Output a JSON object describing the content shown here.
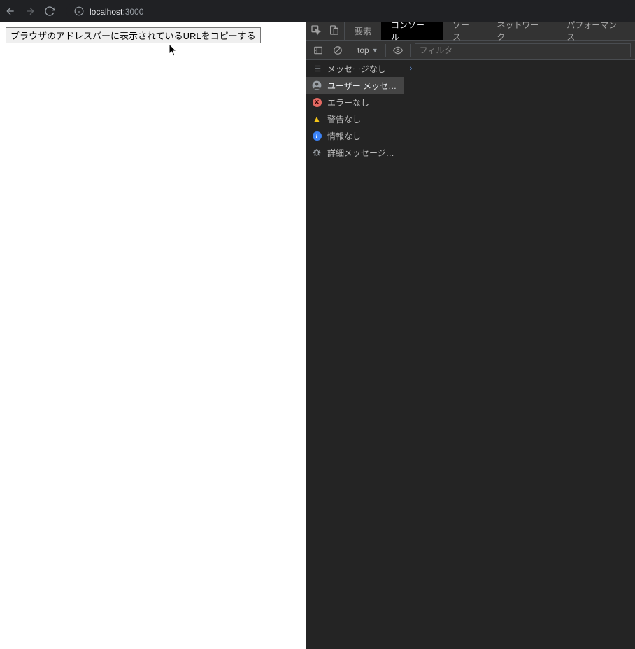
{
  "address": {
    "host": "localhost",
    "port": ":3000"
  },
  "page": {
    "button_label": "ブラウザのアドレスバーに表示されているURLをコピーする"
  },
  "devtools": {
    "tabs": {
      "elements": "要素",
      "console": "コンソール",
      "sources": "ソース",
      "network": "ネットワーク",
      "performance": "パフォーマンス"
    },
    "toolbar": {
      "context": "top",
      "filter_placeholder": "フィルタ"
    },
    "sidebar": {
      "messages": "メッセージなし",
      "user": "ユーザー メッセージなし",
      "errors": "エラーなし",
      "warnings": "警告なし",
      "info": "情報なし",
      "verbose": "詳細メッセージなし"
    },
    "prompt": "›"
  }
}
